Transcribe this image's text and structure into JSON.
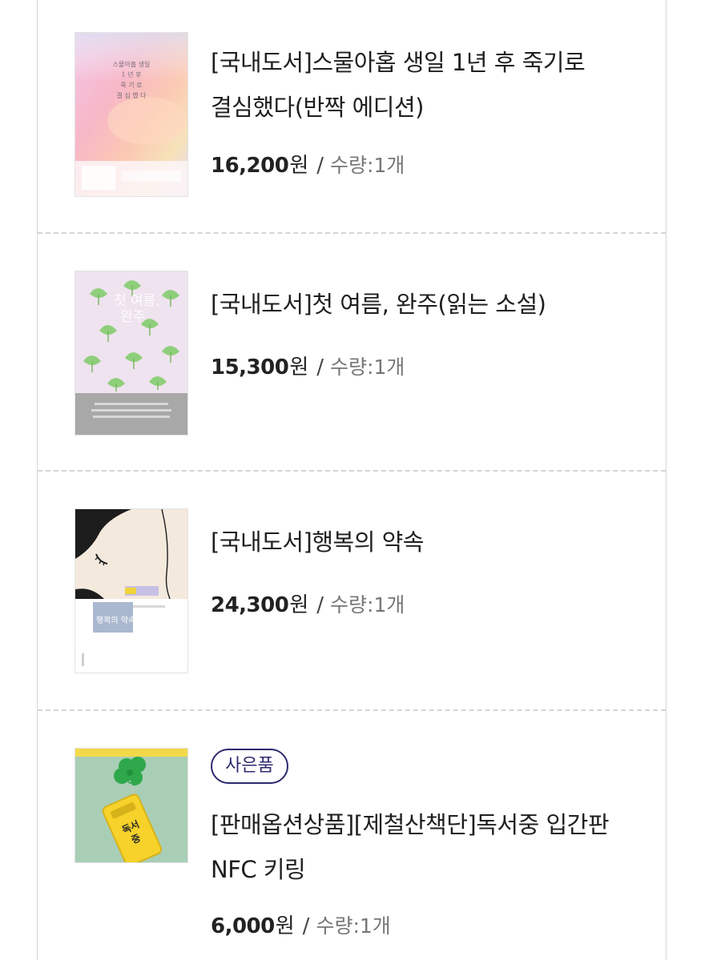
{
  "cart_items": [
    {
      "title_line1": "[국내도서]스물아홉 생일 1년 후 죽기로",
      "title_line2": "결심했다(반짝 에디션)",
      "price": "16,200",
      "currency": "원",
      "separator": "/",
      "quantity": "수량:1개",
      "cover_text": [
        "스물아홉 생일",
        "1 년 후",
        "죽 기 로",
        "결 심 했 다"
      ]
    },
    {
      "title_line1": "[국내도서]첫 여름, 완주(읽는 소설)",
      "price": "15,300",
      "currency": "원",
      "separator": "/",
      "quantity": "수량:1개",
      "cover_text": [
        "첫 여름,",
        "완주"
      ]
    },
    {
      "title_line1": "[국내도서]행복의 약속",
      "price": "24,300",
      "currency": "원",
      "separator": "/",
      "quantity": "수량:1개",
      "cover_text": [
        "행복의 약속"
      ]
    },
    {
      "badge": "사은품",
      "title_line1": "[판매옵션상품][제철산책단]독서중 입간판",
      "title_line2": "NFC 키링",
      "price": "6,000",
      "currency": "원",
      "separator": "/",
      "quantity": "수량:1개",
      "cover_text": [
        "독서",
        "중"
      ]
    }
  ],
  "colors": {
    "badge": "#2d2a6e",
    "divider": "#d4d4d4",
    "quantity_text": "#777777"
  }
}
